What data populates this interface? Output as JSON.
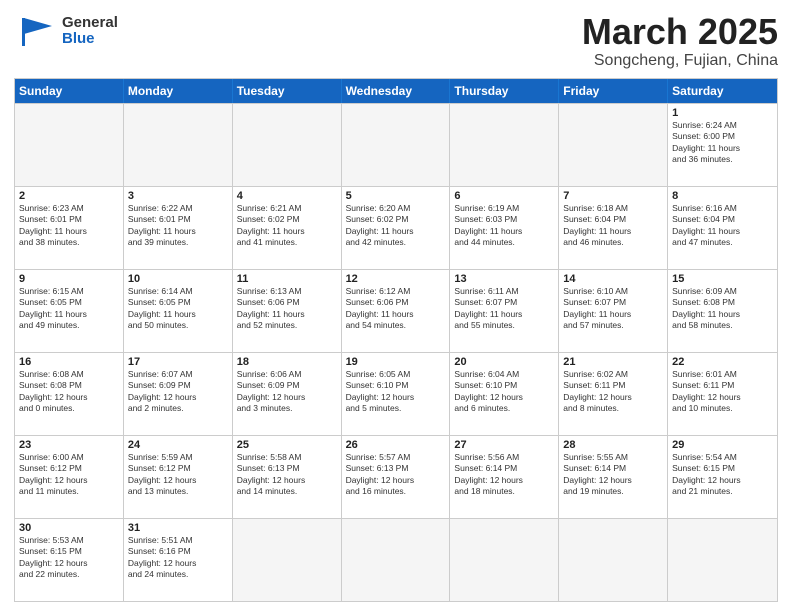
{
  "header": {
    "logo_general": "General",
    "logo_blue": "Blue",
    "title": "March 2025",
    "subtitle": "Songcheng, Fujian, China"
  },
  "days_of_week": [
    "Sunday",
    "Monday",
    "Tuesday",
    "Wednesday",
    "Thursday",
    "Friday",
    "Saturday"
  ],
  "weeks": [
    [
      {
        "day": "",
        "info": ""
      },
      {
        "day": "",
        "info": ""
      },
      {
        "day": "",
        "info": ""
      },
      {
        "day": "",
        "info": ""
      },
      {
        "day": "",
        "info": ""
      },
      {
        "day": "",
        "info": ""
      },
      {
        "day": "1",
        "info": "Sunrise: 6:24 AM\nSunset: 6:00 PM\nDaylight: 11 hours\nand 36 minutes."
      }
    ],
    [
      {
        "day": "2",
        "info": "Sunrise: 6:23 AM\nSunset: 6:01 PM\nDaylight: 11 hours\nand 38 minutes."
      },
      {
        "day": "3",
        "info": "Sunrise: 6:22 AM\nSunset: 6:01 PM\nDaylight: 11 hours\nand 39 minutes."
      },
      {
        "day": "4",
        "info": "Sunrise: 6:21 AM\nSunset: 6:02 PM\nDaylight: 11 hours\nand 41 minutes."
      },
      {
        "day": "5",
        "info": "Sunrise: 6:20 AM\nSunset: 6:02 PM\nDaylight: 11 hours\nand 42 minutes."
      },
      {
        "day": "6",
        "info": "Sunrise: 6:19 AM\nSunset: 6:03 PM\nDaylight: 11 hours\nand 44 minutes."
      },
      {
        "day": "7",
        "info": "Sunrise: 6:18 AM\nSunset: 6:04 PM\nDaylight: 11 hours\nand 46 minutes."
      },
      {
        "day": "8",
        "info": "Sunrise: 6:16 AM\nSunset: 6:04 PM\nDaylight: 11 hours\nand 47 minutes."
      }
    ],
    [
      {
        "day": "9",
        "info": "Sunrise: 6:15 AM\nSunset: 6:05 PM\nDaylight: 11 hours\nand 49 minutes."
      },
      {
        "day": "10",
        "info": "Sunrise: 6:14 AM\nSunset: 6:05 PM\nDaylight: 11 hours\nand 50 minutes."
      },
      {
        "day": "11",
        "info": "Sunrise: 6:13 AM\nSunset: 6:06 PM\nDaylight: 11 hours\nand 52 minutes."
      },
      {
        "day": "12",
        "info": "Sunrise: 6:12 AM\nSunset: 6:06 PM\nDaylight: 11 hours\nand 54 minutes."
      },
      {
        "day": "13",
        "info": "Sunrise: 6:11 AM\nSunset: 6:07 PM\nDaylight: 11 hours\nand 55 minutes."
      },
      {
        "day": "14",
        "info": "Sunrise: 6:10 AM\nSunset: 6:07 PM\nDaylight: 11 hours\nand 57 minutes."
      },
      {
        "day": "15",
        "info": "Sunrise: 6:09 AM\nSunset: 6:08 PM\nDaylight: 11 hours\nand 58 minutes."
      }
    ],
    [
      {
        "day": "16",
        "info": "Sunrise: 6:08 AM\nSunset: 6:08 PM\nDaylight: 12 hours\nand 0 minutes."
      },
      {
        "day": "17",
        "info": "Sunrise: 6:07 AM\nSunset: 6:09 PM\nDaylight: 12 hours\nand 2 minutes."
      },
      {
        "day": "18",
        "info": "Sunrise: 6:06 AM\nSunset: 6:09 PM\nDaylight: 12 hours\nand 3 minutes."
      },
      {
        "day": "19",
        "info": "Sunrise: 6:05 AM\nSunset: 6:10 PM\nDaylight: 12 hours\nand 5 minutes."
      },
      {
        "day": "20",
        "info": "Sunrise: 6:04 AM\nSunset: 6:10 PM\nDaylight: 12 hours\nand 6 minutes."
      },
      {
        "day": "21",
        "info": "Sunrise: 6:02 AM\nSunset: 6:11 PM\nDaylight: 12 hours\nand 8 minutes."
      },
      {
        "day": "22",
        "info": "Sunrise: 6:01 AM\nSunset: 6:11 PM\nDaylight: 12 hours\nand 10 minutes."
      }
    ],
    [
      {
        "day": "23",
        "info": "Sunrise: 6:00 AM\nSunset: 6:12 PM\nDaylight: 12 hours\nand 11 minutes."
      },
      {
        "day": "24",
        "info": "Sunrise: 5:59 AM\nSunset: 6:12 PM\nDaylight: 12 hours\nand 13 minutes."
      },
      {
        "day": "25",
        "info": "Sunrise: 5:58 AM\nSunset: 6:13 PM\nDaylight: 12 hours\nand 14 minutes."
      },
      {
        "day": "26",
        "info": "Sunrise: 5:57 AM\nSunset: 6:13 PM\nDaylight: 12 hours\nand 16 minutes."
      },
      {
        "day": "27",
        "info": "Sunrise: 5:56 AM\nSunset: 6:14 PM\nDaylight: 12 hours\nand 18 minutes."
      },
      {
        "day": "28",
        "info": "Sunrise: 5:55 AM\nSunset: 6:14 PM\nDaylight: 12 hours\nand 19 minutes."
      },
      {
        "day": "29",
        "info": "Sunrise: 5:54 AM\nSunset: 6:15 PM\nDaylight: 12 hours\nand 21 minutes."
      }
    ],
    [
      {
        "day": "30",
        "info": "Sunrise: 5:53 AM\nSunset: 6:15 PM\nDaylight: 12 hours\nand 22 minutes."
      },
      {
        "day": "31",
        "info": "Sunrise: 5:51 AM\nSunset: 6:16 PM\nDaylight: 12 hours\nand 24 minutes."
      },
      {
        "day": "",
        "info": ""
      },
      {
        "day": "",
        "info": ""
      },
      {
        "day": "",
        "info": ""
      },
      {
        "day": "",
        "info": ""
      },
      {
        "day": "",
        "info": ""
      }
    ]
  ]
}
